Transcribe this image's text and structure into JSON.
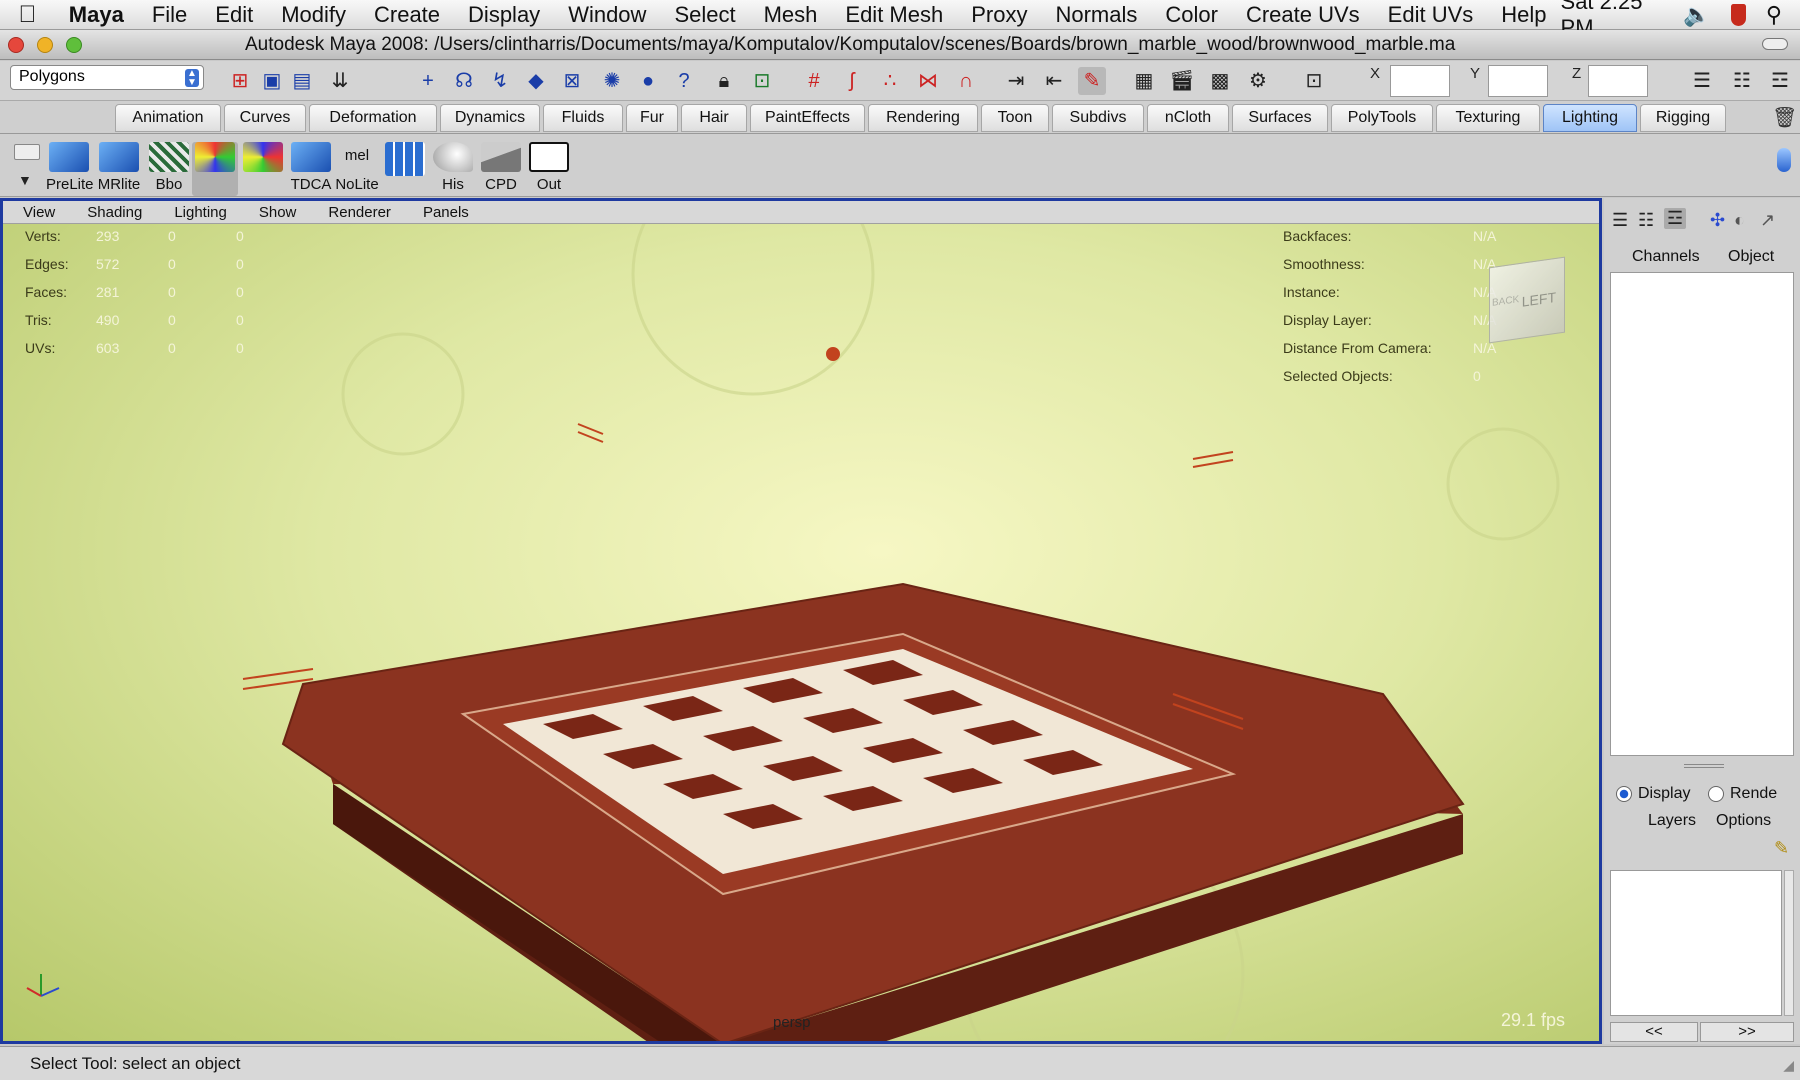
{
  "menubar": {
    "app": "Maya",
    "items": [
      "File",
      "Edit",
      "Modify",
      "Create",
      "Display",
      "Window",
      "Select",
      "Mesh",
      "Edit Mesh",
      "Proxy",
      "Normals",
      "Color",
      "Create UVs",
      "Edit UVs",
      "Help"
    ],
    "clock": "Sat 2:25 PM"
  },
  "window": {
    "title": "Autodesk Maya 2008: /Users/clintharris/Documents/maya/Komputalov/Komputalov/scenes/Boards/brown_marble_wood/brownwood_marble.ma"
  },
  "statusline": {
    "mode": "Polygons",
    "x_label": "X",
    "y_label": "Y",
    "z_label": "Z",
    "x_value": "",
    "y_value": "",
    "z_value": ""
  },
  "shelf_tabs": [
    {
      "label": "Animation",
      "active": false
    },
    {
      "label": "Curves",
      "active": false
    },
    {
      "label": "Deformation",
      "active": false
    },
    {
      "label": "Dynamics",
      "active": false
    },
    {
      "label": "Fluids",
      "active": false
    },
    {
      "label": "Fur",
      "active": false
    },
    {
      "label": "Hair",
      "active": false
    },
    {
      "label": "PaintEffects",
      "active": false
    },
    {
      "label": "Rendering",
      "active": false
    },
    {
      "label": "Toon",
      "active": false
    },
    {
      "label": "Subdivs",
      "active": false
    },
    {
      "label": "nCloth",
      "active": false
    },
    {
      "label": "Surfaces",
      "active": false
    },
    {
      "label": "PolyTools",
      "active": false
    },
    {
      "label": "Texturing",
      "active": false
    },
    {
      "label": "Lighting",
      "active": true
    },
    {
      "label": "Rigging",
      "active": false
    }
  ],
  "shelf_buttons": [
    "PreLite",
    "MRlite",
    "Bbo",
    "",
    "",
    "TDCA",
    "NoLite",
    "",
    "His",
    "CPD",
    "Out"
  ],
  "shelf_mel": "mel",
  "panel_menu": [
    "View",
    "Shading",
    "Lighting",
    "Show",
    "Renderer",
    "Panels"
  ],
  "hud_left": {
    "labels": [
      "Verts:",
      "Edges:",
      "Faces:",
      "Tris:",
      "UVs:"
    ],
    "rows": [
      [
        "293",
        "0",
        "0"
      ],
      [
        "572",
        "0",
        "0"
      ],
      [
        "281",
        "0",
        "0"
      ],
      [
        "490",
        "0",
        "0"
      ],
      [
        "603",
        "0",
        "0"
      ]
    ]
  },
  "hud_right": {
    "labels": [
      "Backfaces:",
      "Smoothness:",
      "Instance:",
      "Display Layer:",
      "Distance From Camera:",
      "Selected Objects:"
    ],
    "values": [
      "N/A",
      "N/A",
      "N/A",
      "N/A",
      "N/A",
      "0"
    ]
  },
  "viewcube": {
    "front": "LEFT",
    "side": "BACK"
  },
  "camera_name": "persp",
  "fps": "29.1 fps",
  "channel_box": {
    "tab_channels": "Channels",
    "tab_object": "Object"
  },
  "layer_editor": {
    "radio_display": "Display",
    "radio_render": "Rende",
    "layers_menu": "Layers",
    "options_menu": "Options",
    "prev": "<<",
    "next": ">>"
  },
  "helpline": "Select Tool: select an object",
  "colors": {
    "viewport_border": "#1e3aa0",
    "active_tab": "#a6c8f6",
    "wood": "#7a2a18"
  }
}
